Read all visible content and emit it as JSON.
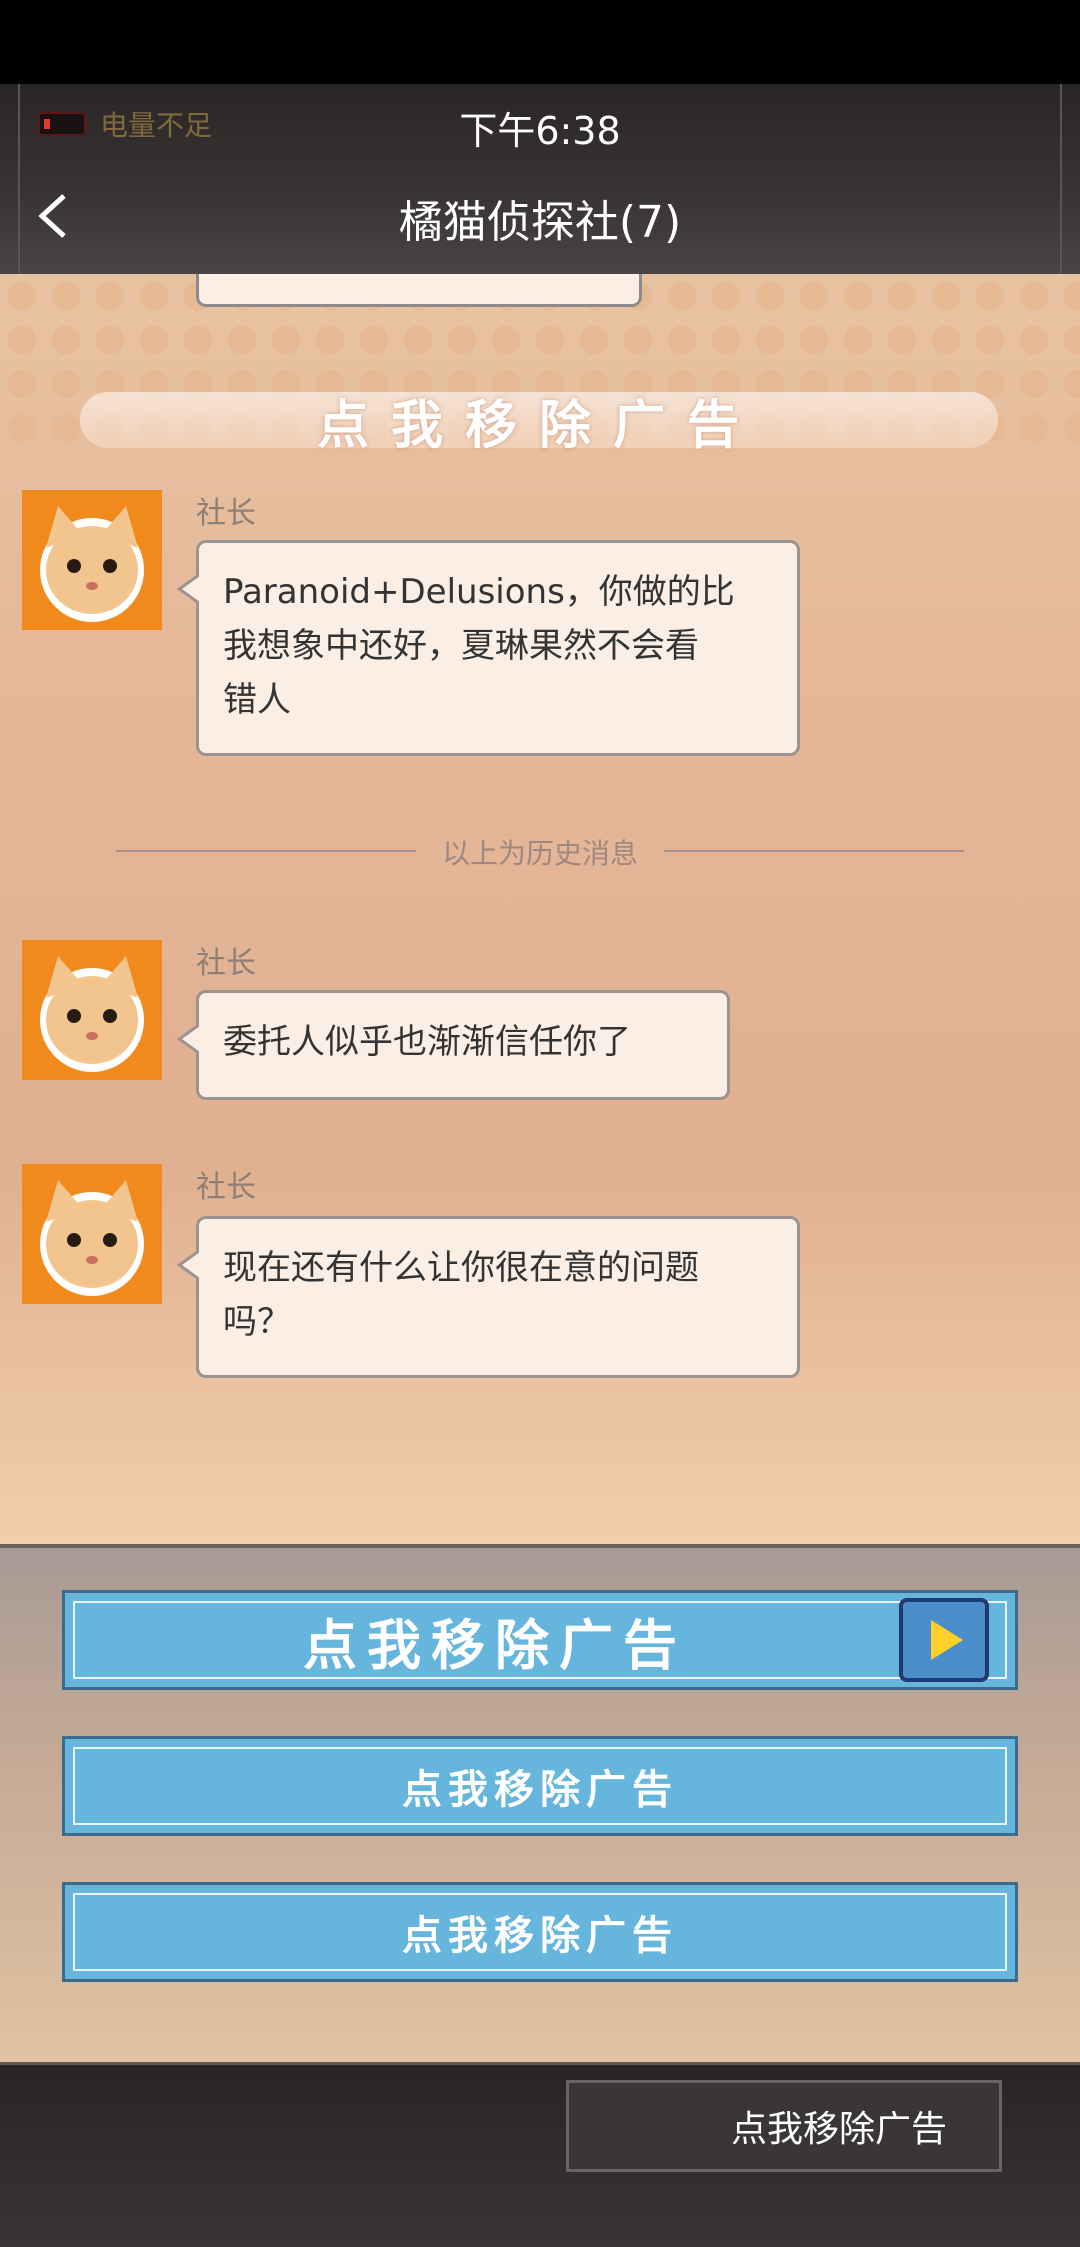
{
  "status_bar": {
    "battery_text": "电量不足",
    "time": "下午6:38"
  },
  "header": {
    "title": "橘猫侦探社(7)"
  },
  "chat": {
    "ad_banner": "点我移除广告",
    "divider_text": "以上为历史消息",
    "messages": [
      {
        "sender": "社长",
        "text_lines": [
          "Paranoid+Delusions，你做的比",
          "我想象中还好，夏琳果然不会看",
          "错人"
        ]
      },
      {
        "sender": "社长",
        "text_lines": [
          "委托人似乎也渐渐信任你了"
        ]
      },
      {
        "sender": "社长",
        "text_lines": [
          "现在还有什么让你很在意的问题",
          "吗？"
        ]
      }
    ]
  },
  "options": [
    {
      "label": "点我移除广告",
      "icon": "play-icon"
    },
    {
      "label": "点我移除广告"
    },
    {
      "label": "点我移除广告"
    }
  ],
  "bottom": {
    "button_label": "点我移除广告"
  },
  "colors": {
    "option_blue": "#66b5dc",
    "bubble_bg": "#fbeee4",
    "avatar_orange": "#f08a1c"
  }
}
